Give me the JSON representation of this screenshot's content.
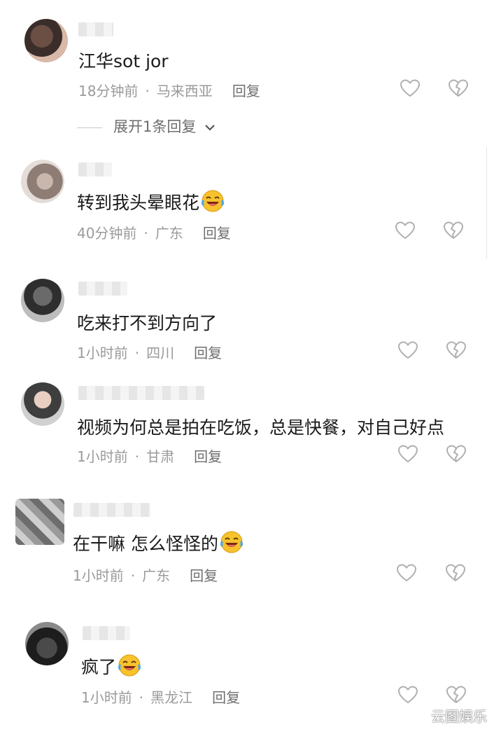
{
  "comments": [
    {
      "text": "江华sot jor",
      "time": "18分钟前",
      "location": "马来西亚",
      "reply": "回复",
      "emoji": false
    },
    {
      "text": "转到我头晕眼花",
      "time": "40分钟前",
      "location": "广东",
      "reply": "回复",
      "emoji": true
    },
    {
      "text": "吃来打不到方向了",
      "time": "1小时前",
      "location": "四川",
      "reply": "回复",
      "emoji": false
    },
    {
      "text": "视频为何总是拍在吃饭，总是快餐，对自己好点",
      "time": "1小时前",
      "location": "甘肃",
      "reply": "回复",
      "emoji": false
    },
    {
      "text": "在干嘛 怎么怪怪的",
      "time": "1小时前",
      "location": "广东",
      "reply": "回复",
      "emoji": true
    },
    {
      "text": "疯了",
      "time": "1小时前",
      "location": "黑龙江",
      "reply": "回复",
      "emoji": true
    }
  ],
  "expand_replies": "展开1条回复",
  "separator": "·",
  "watermark": "云图娱乐",
  "colors": {
    "text": "#1a1a1a",
    "meta": "#9a9a9a",
    "icon": "#b0b0b0",
    "emoji": "#f7c22c"
  },
  "icons": {
    "like": "heart-outline-icon",
    "dislike": "broken-heart-icon",
    "emoji": "laughing-crying-emoji-icon",
    "chevron": "chevron-down-icon"
  }
}
